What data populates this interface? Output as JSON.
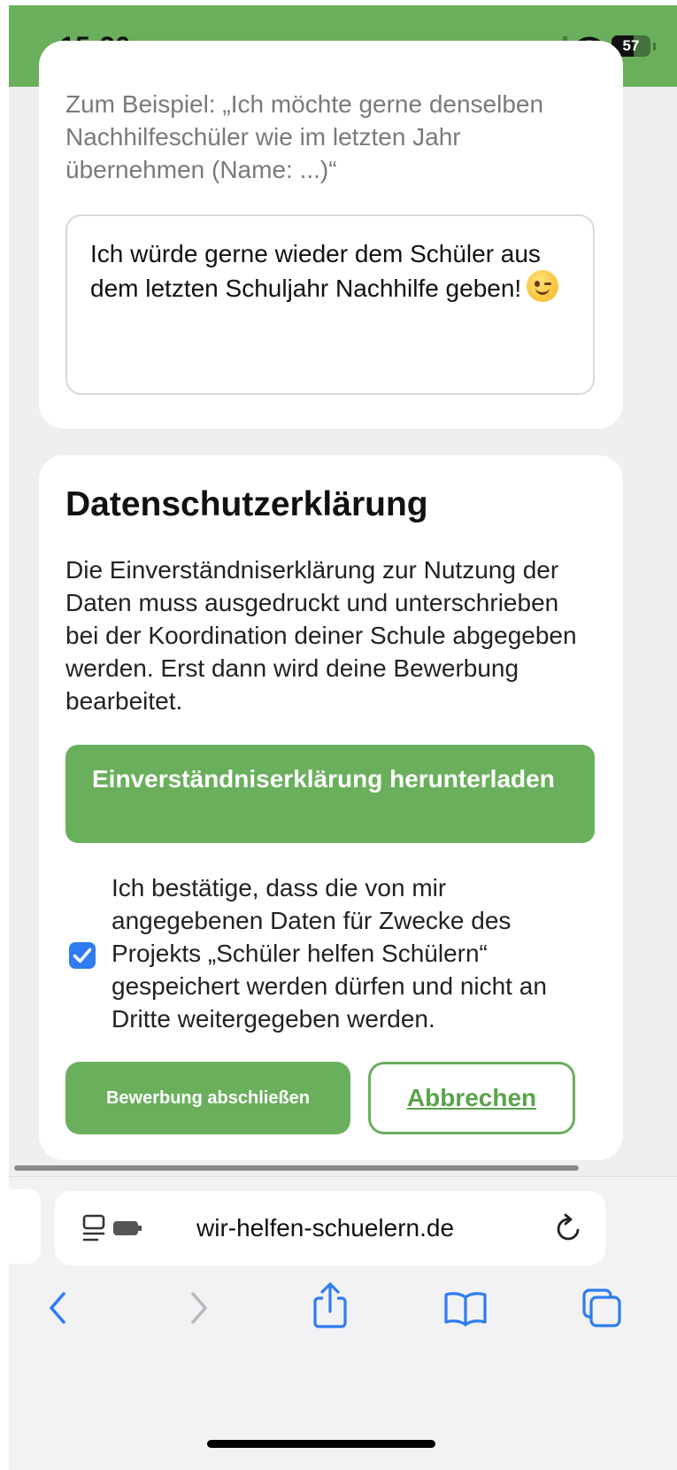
{
  "status_bar": {
    "time": "15:36",
    "battery": "57",
    "battery_level": 0.57,
    "icons": [
      "signal-icon",
      "wifi-icon",
      "battery-icon"
    ]
  },
  "preference_card": {
    "hint": "Zum Beispiel: „Ich möchte gerne denselben Nachhilfeschüler wie im letzten Jahr übernehmen (Name: ...)“",
    "textarea_value": "Ich würde gerne wieder dem Schüler aus dem letzten Schuljahr Nachhilfe geben!",
    "textarea_emoji": "winking-face-emoji"
  },
  "privacy": {
    "title": "Datenschutzerklärung",
    "body": "Die Einverständniserklärung zur Nutzung der Daten muss ausgedruckt und unterschrieben bei der Koordination deiner Schule abgegeben werden. Erst dann wird deine Bewerbung bearbeitet.",
    "download_label": "Einverständniserklärung herunterladen",
    "consent_checked": true,
    "consent_label": "Ich bestätige, dass die von mir angegebenen Daten für Zwecke des Projekts „Schüler helfen Schülern“ gespeichert werden dürfen und nicht an Dritte weitergegeben werden.",
    "submit_label": "Bewerbung abschließen",
    "cancel_label": "Abbrechen"
  },
  "browser": {
    "url": "wir-helfen-schuelern.de",
    "toolbar": [
      "back-icon",
      "forward-icon",
      "share-icon",
      "bookmarks-icon",
      "tabs-icon"
    ]
  },
  "colors": {
    "accent_green": "#6aaf5c",
    "checkbox_blue": "#2f7cf0",
    "ios_blue": "#2f7cf0"
  }
}
